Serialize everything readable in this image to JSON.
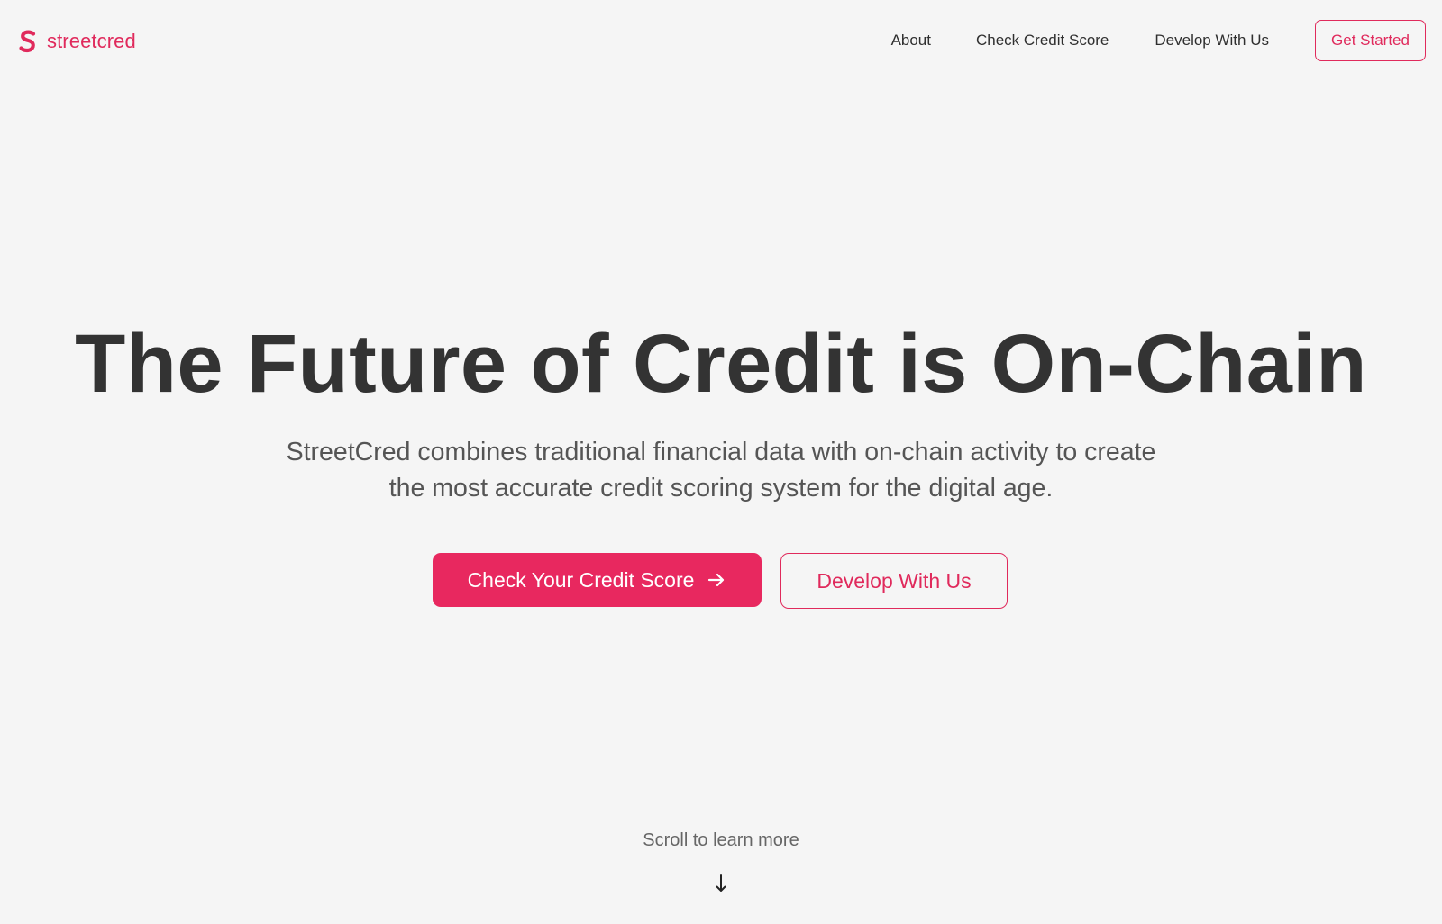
{
  "brand": {
    "name": "streetcred",
    "accent_color": "#e02a5c",
    "logo_icon": "s-logo-icon"
  },
  "nav": {
    "items": [
      {
        "label": "About"
      },
      {
        "label": "Check Credit Score"
      },
      {
        "label": "Develop With Us"
      }
    ],
    "cta_label": "Get Started"
  },
  "hero": {
    "title": "The Future of Credit is On-Chain",
    "subtitle": "StreetCred combines traditional financial data with on-chain activity to create the most accurate credit scoring system for the digital age.",
    "primary_cta": {
      "label": "Check Your Credit Score",
      "icon": "arrow-right-icon",
      "color": "#e8285f"
    },
    "secondary_cta": {
      "label": "Develop With Us"
    }
  },
  "scroll": {
    "label": "Scroll to learn more",
    "icon": "arrow-down-icon"
  }
}
